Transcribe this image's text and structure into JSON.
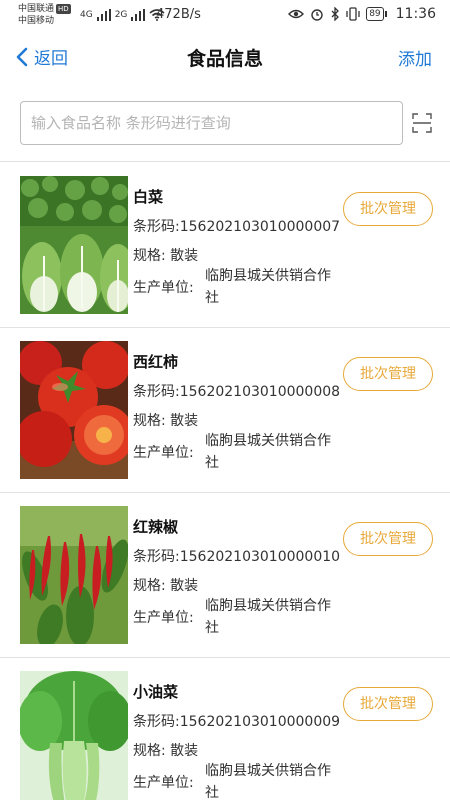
{
  "status_bar": {
    "carrier1": "中国联通",
    "hd_badge": "HD",
    "carrier2": "中国移动",
    "signal1_type": "4G",
    "signal2_type": "2G",
    "net_speed": "472B/s",
    "battery": "89",
    "time": "11:36"
  },
  "nav": {
    "back_label": "返回",
    "title": "食品信息",
    "add_label": "添加"
  },
  "search": {
    "value": "",
    "placeholder": "输入食品名称 条形码进行查询",
    "scan_icon": "scan-icon"
  },
  "items": [
    {
      "name": "白菜",
      "barcode_label": "条形码:",
      "barcode": "156202103010000007",
      "spec_label": "规格:",
      "spec": "散装",
      "producer_label": "生产单位:",
      "producer": "临朐县城关供销合作社",
      "button": "批次管理",
      "image": "cabbage"
    },
    {
      "name": "西红柿",
      "barcode_label": "条形码:",
      "barcode": "156202103010000008",
      "spec_label": "规格:",
      "spec": "散装",
      "producer_label": "生产单位:",
      "producer": "临朐县城关供销合作社",
      "button": "批次管理",
      "image": "tomato"
    },
    {
      "name": "红辣椒",
      "barcode_label": "条形码:",
      "barcode": "156202103010000010",
      "spec_label": "规格:",
      "spec": "散装",
      "producer_label": "生产单位:",
      "producer": "临朐县城关供销合作社",
      "button": "批次管理",
      "image": "red-pepper"
    },
    {
      "name": "小油菜",
      "barcode_label": "条形码:",
      "barcode": "156202103010000009",
      "spec_label": "规格:",
      "spec": "散装",
      "producer_label": "生产单位:",
      "producer": "临朐县城关供销合作社",
      "button": "批次管理",
      "image": "bok-choy"
    }
  ],
  "colors": {
    "accent_blue": "#1f7ad6",
    "button_orange": "#e8a93b",
    "divider": "#e2e2e2"
  }
}
